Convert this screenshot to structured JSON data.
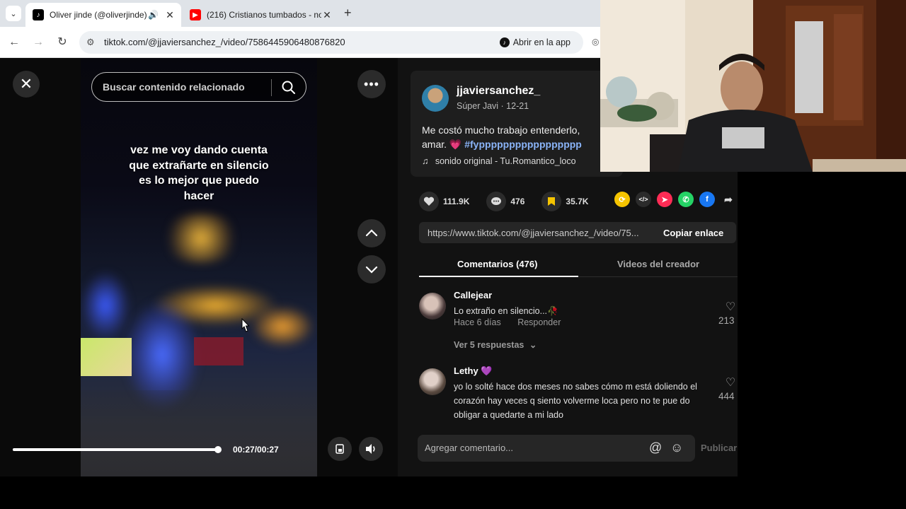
{
  "browser": {
    "tabs": [
      {
        "title": "Oliver jinde (@oliverjinde) |",
        "active": true
      },
      {
        "title": "(216) Cristianos tumbados - no",
        "active": false
      }
    ],
    "new_tab_symbol": "+",
    "url": "tiktok.com/@jjaviersanchez_/video/7586445906480876820",
    "open_app_label": "Abrir en la app"
  },
  "player": {
    "search_placeholder": "Buscar contenido relacionado",
    "caption_lines": [
      "vez me voy dando cuenta",
      "que extrañarte en silencio",
      "es lo mejor que puedo",
      "hacer"
    ],
    "time": "00:27/00:27",
    "progress": 1.0
  },
  "post": {
    "username": "jjaviersanchez_",
    "nickname_date": "Súper Javi · 12-21",
    "description": "Me costó mucho trabajo entenderlo,",
    "description_line2": "amar. 💗",
    "hashtag": "#fyppppppppppppppppp",
    "music": "sonido original - Tu.Romantico_loco",
    "likes": "111.9K",
    "comments": "476",
    "saves": "35.7K",
    "link": "https://www.tiktok.com/@jjaviersanchez_/video/75...",
    "copy_link_label": "Copiar enlace"
  },
  "panel_tabs": {
    "comments": "Comentarios (476)",
    "creator_videos": "Videos del creador"
  },
  "comments": [
    {
      "user": "Callejear",
      "text": "Lo extraño en silencio...🥀",
      "time": "Hace 6 días",
      "reply": "Responder",
      "replies": "Ver 5 respuestas",
      "likes": "213"
    },
    {
      "user": "Lethy 💜",
      "text": "yo lo solté hace dos meses no sabes cómo m está doliendo el corazón hay veces q siento volverme loca pero no te pue do obligar a quedarte a mi lado",
      "likes": "444"
    }
  ],
  "composer": {
    "placeholder": "Agregar comentario...",
    "publish_label": "Publicar"
  },
  "colors": {
    "panel_bg": "#121212",
    "accent_link": "#8ab4f8",
    "save_icon": "#f5c400"
  }
}
